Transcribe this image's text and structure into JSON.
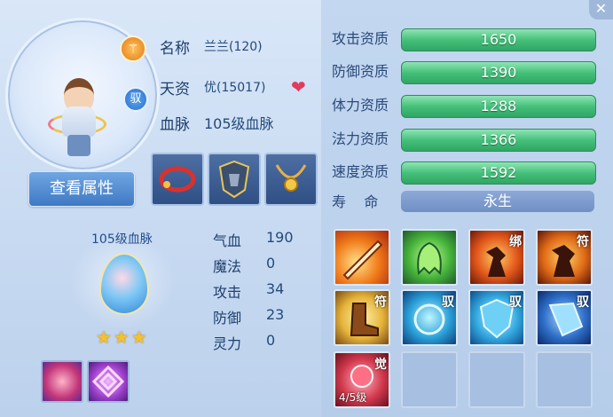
{
  "pet": {
    "name_label": "名称",
    "name_value": "兰兰(120)",
    "aptitude_label": "天资",
    "aptitude_value": "优(15017)",
    "bloodline_label": "血脉",
    "bloodline_value": "105级血脉",
    "role_badge": "⚚",
    "yu_badge": "驭"
  },
  "buttons": {
    "view_attributes": "查看属性"
  },
  "bloodline_panel": {
    "title": "105级血脉",
    "stars": 3
  },
  "stats": [
    {
      "label": "气血",
      "value": "190"
    },
    {
      "label": "魔法",
      "value": "0"
    },
    {
      "label": "攻击",
      "value": "34"
    },
    {
      "label": "防御",
      "value": "23"
    },
    {
      "label": "灵力",
      "value": "0"
    }
  ],
  "aptitudes": [
    {
      "label": "攻击资质",
      "value": "1650"
    },
    {
      "label": "防御资质",
      "value": "1390"
    },
    {
      "label": "体力资质",
      "value": "1288"
    },
    {
      "label": "法力资质",
      "value": "1366"
    },
    {
      "label": "速度资质",
      "value": "1592"
    }
  ],
  "lifespan": {
    "label": "寿    命",
    "value": "永生"
  },
  "skills": [
    {
      "name": "sword-slash",
      "tag": "",
      "label": ""
    },
    {
      "name": "ghost-poison",
      "tag": "",
      "label": ""
    },
    {
      "name": "bind-strike",
      "tag": "绑",
      "label": ""
    },
    {
      "name": "talisman-warrior",
      "tag": "符",
      "label": ""
    },
    {
      "name": "talisman-boot",
      "tag": "符",
      "label": ""
    },
    {
      "name": "water-orb",
      "tag": "驭",
      "label": ""
    },
    {
      "name": "shield",
      "tag": "驭",
      "label": ""
    },
    {
      "name": "crystal-shard",
      "tag": "驭",
      "label": ""
    },
    {
      "name": "awaken-rose",
      "tag": "觉",
      "label": "4/5级"
    }
  ],
  "colors": {
    "bar_green": "#45c07b",
    "accent_blue": "#3f79c4",
    "heart": "#e23b5e"
  }
}
